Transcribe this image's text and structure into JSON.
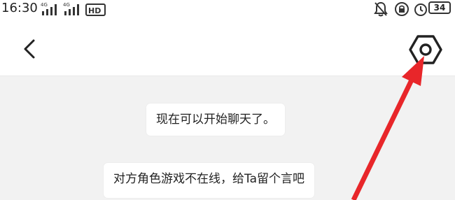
{
  "status_bar": {
    "time": "16:30",
    "signal_1_label": "4G",
    "signal_2_label": "4G",
    "hd_label": "HD",
    "battery": "34",
    "icons": [
      "bell-off-icon",
      "lock-rotation-icon",
      "alarm-icon",
      "battery-icon"
    ]
  },
  "header": {
    "back_icon": "chevron-left-icon",
    "settings_icon": "hex-gear-icon"
  },
  "chat": {
    "messages": [
      "现在可以开始聊天了。",
      "对方角色游戏不在线，给Ta留个言吧"
    ]
  },
  "annotation": {
    "arrow_color": "#e8262a"
  }
}
